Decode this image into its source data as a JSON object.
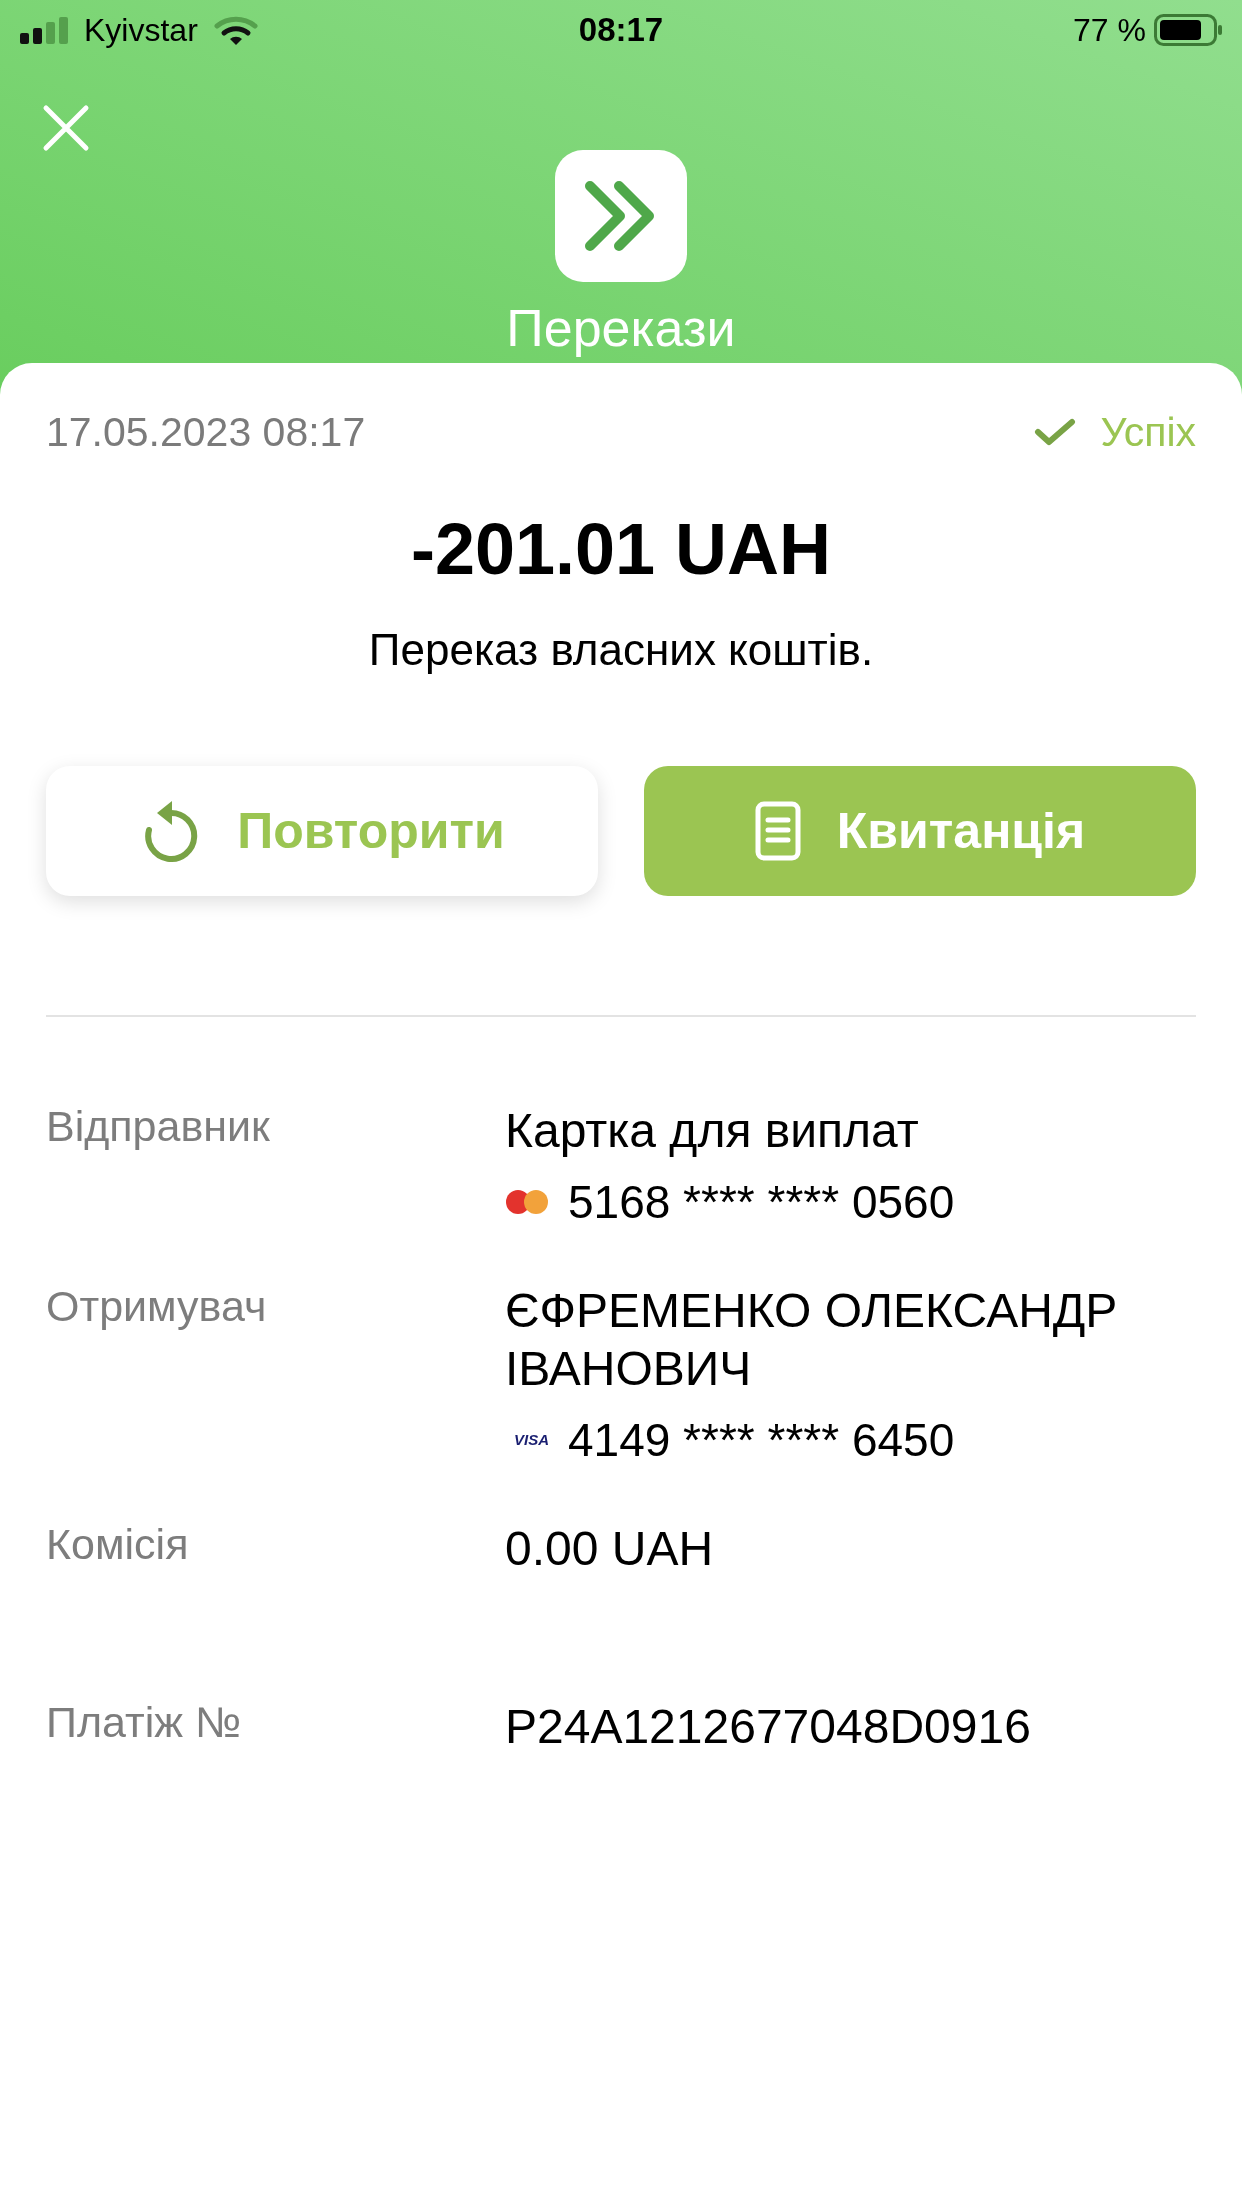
{
  "status_bar": {
    "carrier": "Kyivstar",
    "time": "08:17",
    "battery_text": "77 %"
  },
  "header": {
    "title": "Перекази"
  },
  "transaction": {
    "datetime": "17.05.2023 08:17",
    "status": {
      "kind": "success",
      "label": "Успіх"
    },
    "amount": "-201.01 UAH",
    "description": "Переказ власних коштів."
  },
  "actions": [
    {
      "kind": "repeat",
      "label": "Повторити",
      "primary": false
    },
    {
      "kind": "receipt",
      "label": "Квитанція",
      "primary": true
    }
  ],
  "details": [
    {
      "label": "Відправник",
      "value": "Картка для виплат",
      "card": {
        "kind": "mastercard",
        "number": "5168 **** **** 0560"
      }
    },
    {
      "label": "Отримувач",
      "value": "ЄФРЕМЕНКО ОЛЕКСАНДР ІВАНОВИЧ",
      "card": {
        "kind": "visa",
        "logo_text": "VISA",
        "number": "4149 **** **** 6450"
      }
    },
    {
      "label": "Комісія",
      "value": "0.00 UAH"
    },
    {
      "label": "Платіж №",
      "value": "P24A1212677048D0916"
    }
  ]
}
